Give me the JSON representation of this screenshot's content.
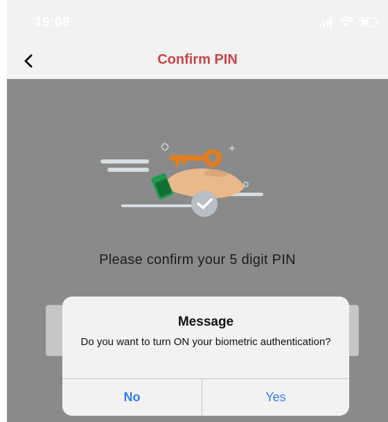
{
  "status_bar": {
    "time": "19:08"
  },
  "nav": {
    "title": "Confirm PIN",
    "title_color": "#c8454a"
  },
  "main": {
    "instruction": "Please confirm your 5 digit PIN"
  },
  "dialog": {
    "title": "Message",
    "message": "Do you want to turn ON your biometric authentication?",
    "buttons": {
      "no": "No",
      "yes": "Yes"
    },
    "button_color": "#2f7cf6"
  },
  "icons": {
    "back": "chevron-left-icon",
    "signal": "signal-icon",
    "wifi": "wifi-icon",
    "battery": "battery-icon",
    "illustration": "key-hand-check-illustration"
  }
}
